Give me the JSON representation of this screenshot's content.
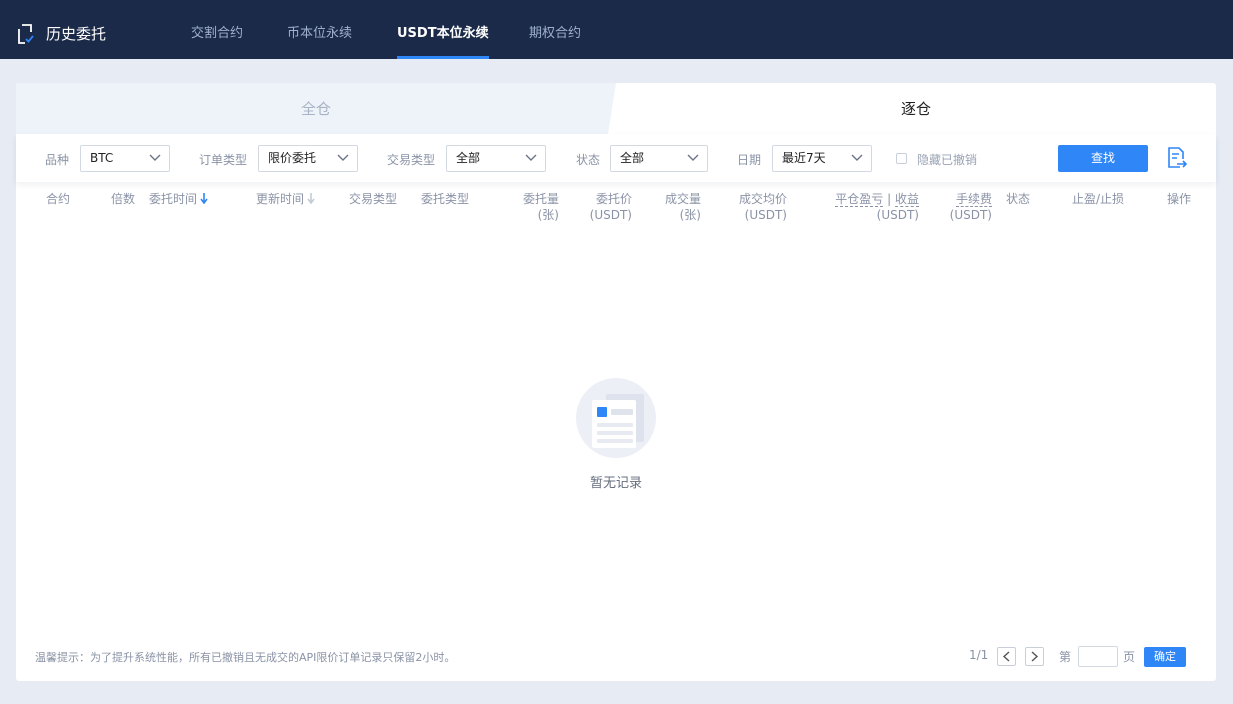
{
  "header": {
    "title": "历史委托",
    "tabs": [
      {
        "label": "交割合约"
      },
      {
        "label": "币本位永续"
      },
      {
        "label": "USDT本位永续"
      },
      {
        "label": "期权合约"
      }
    ],
    "active_tab": "USDT本位永续"
  },
  "mode_tabs": {
    "cross": "全仓",
    "isolated": "逐仓",
    "active": "逐仓"
  },
  "filters": {
    "symbol": {
      "label": "品种",
      "value": "BTC"
    },
    "order_type": {
      "label": "订单类型",
      "value": "限价委托"
    },
    "trade_type": {
      "label": "交易类型",
      "value": "全部"
    },
    "status": {
      "label": "状态",
      "value": "全部"
    },
    "date": {
      "label": "日期",
      "value": "最近7天"
    },
    "hide_cancelled": {
      "label": "隐藏已撤销",
      "checked": false
    },
    "search_button": "查找"
  },
  "table": {
    "columns": {
      "contract": "合约",
      "leverage": "倍数",
      "order_time": "委托时间",
      "update_time": "更新时间",
      "trade_type": "交易类型",
      "order_type": "委托类型",
      "order_qty": "委托量",
      "order_qty_unit": "(张)",
      "order_price": "委托价",
      "order_price_unit": "(USDT)",
      "filled_qty": "成交量",
      "filled_qty_unit": "(张)",
      "avg_price": "成交均价",
      "avg_price_unit": "(USDT)",
      "pnl_a": "平仓盈亏",
      "pnl_sep": " | ",
      "pnl_b": "收益",
      "pnl_unit": "(USDT)",
      "fee": "手续费",
      "fee_unit": "(USDT)",
      "status": "状态",
      "tp_sl": "止盈/止损",
      "action": "操作"
    },
    "rows": [],
    "empty_text": "暂无记录"
  },
  "footer": {
    "tip": "温馨提示：为了提升系统性能，所有已撤销且无成交的API限价订单记录只保留2小时。",
    "page_info": "1/1",
    "page_prefix": "第",
    "page_input": "",
    "page_suffix": "页",
    "confirm_button": "确定"
  },
  "colors": {
    "header_bg": "#1b2a48",
    "accent": "#2f86f6",
    "page_bg": "#e6ebf4"
  }
}
